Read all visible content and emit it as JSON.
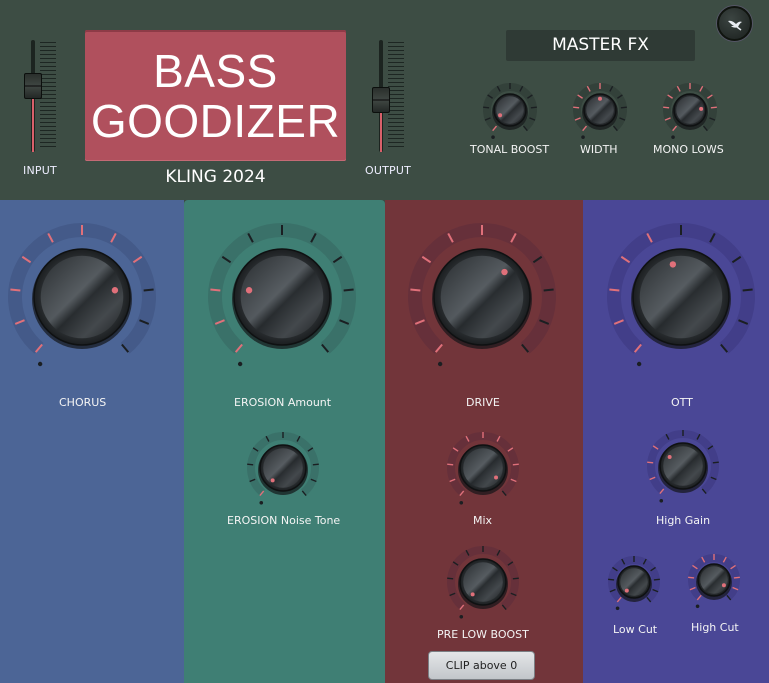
{
  "header": {
    "title_line1": "BASS",
    "title_line2": "GOODIZER",
    "subtitle": "KLING 2024",
    "input_label": "INPUT",
    "output_label": "OUTPUT",
    "input_level": 0.62,
    "output_level": 0.45
  },
  "master": {
    "title": "MASTER FX",
    "knobs": [
      {
        "id": "tonal-boost",
        "label": "TONAL BOOST",
        "value": 0.08
      },
      {
        "id": "width",
        "label": "WIDTH",
        "value": 0.5
      },
      {
        "id": "mono-lows",
        "label": "MONO LOWS",
        "value": 0.8
      }
    ]
  },
  "panels": {
    "chorus": {
      "color": "#4c6596",
      "knobs": [
        {
          "id": "chorus",
          "label": "CHORUS",
          "value": 0.78
        }
      ]
    },
    "erosion": {
      "color": "#3f7f74",
      "knobs": [
        {
          "id": "erosion-amount",
          "label": "EROSION Amount",
          "value": 0.22
        },
        {
          "id": "erosion-noise-tone",
          "label": "EROSION Noise Tone",
          "value": 0.0
        }
      ]
    },
    "drive": {
      "color": "#72353a",
      "knobs": [
        {
          "id": "drive",
          "label": "DRIVE",
          "value": 0.65
        },
        {
          "id": "mix",
          "label": "Mix",
          "value": 0.95
        },
        {
          "id": "pre-low-boost",
          "label": "PRE LOW BOOST",
          "value": 0.0
        }
      ],
      "clip_button": "CLIP above 0"
    },
    "ott": {
      "color": "#4a4796",
      "knobs": [
        {
          "id": "ott",
          "label": "OTT",
          "value": 0.45
        },
        {
          "id": "high-gain",
          "label": "High Gain",
          "value": 0.3
        },
        {
          "id": "low-cut",
          "label": "Low Cut",
          "value": 0.0
        },
        {
          "id": "high-cut",
          "label": "High Cut",
          "value": 0.92
        }
      ]
    }
  },
  "colors": {
    "accent": "#e0707a",
    "tick_dark": "#1b1f22",
    "header_bg": "#3d4d44"
  },
  "icons": {
    "corner_button": "bird-logo-icon"
  }
}
